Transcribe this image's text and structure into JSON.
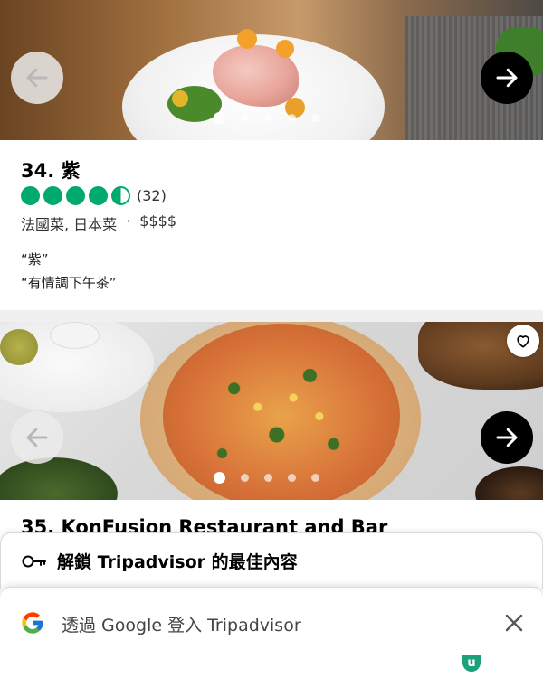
{
  "listings": [
    {
      "rank_title": "34. 紫",
      "rating_bubbles": 4.5,
      "review_count": "(32)",
      "cuisine": "法國菜, 日本菜",
      "separator": "·",
      "price": "$$$$",
      "quotes": [
        "“紫”",
        "“有情調下午茶”"
      ],
      "photo_count": 5,
      "active_photo": 1
    },
    {
      "rank_title": "35. KonFusion Restaurant and Bar",
      "photo_count": 5,
      "active_photo": 1
    }
  ],
  "unlock_banner": {
    "icon": "key-icon",
    "text": "解鎖 Tripadvisor 的最佳內容"
  },
  "google_signin": {
    "icon": "google-g-icon",
    "text": "透過 Google 登入 Tripadvisor",
    "close_icon": "close-icon"
  },
  "footer_badge": "u",
  "colors": {
    "bubble_green": "#00aa6c",
    "arrow_next_bg": "#000000",
    "arrow_prev_bg": "#ebebeb"
  }
}
